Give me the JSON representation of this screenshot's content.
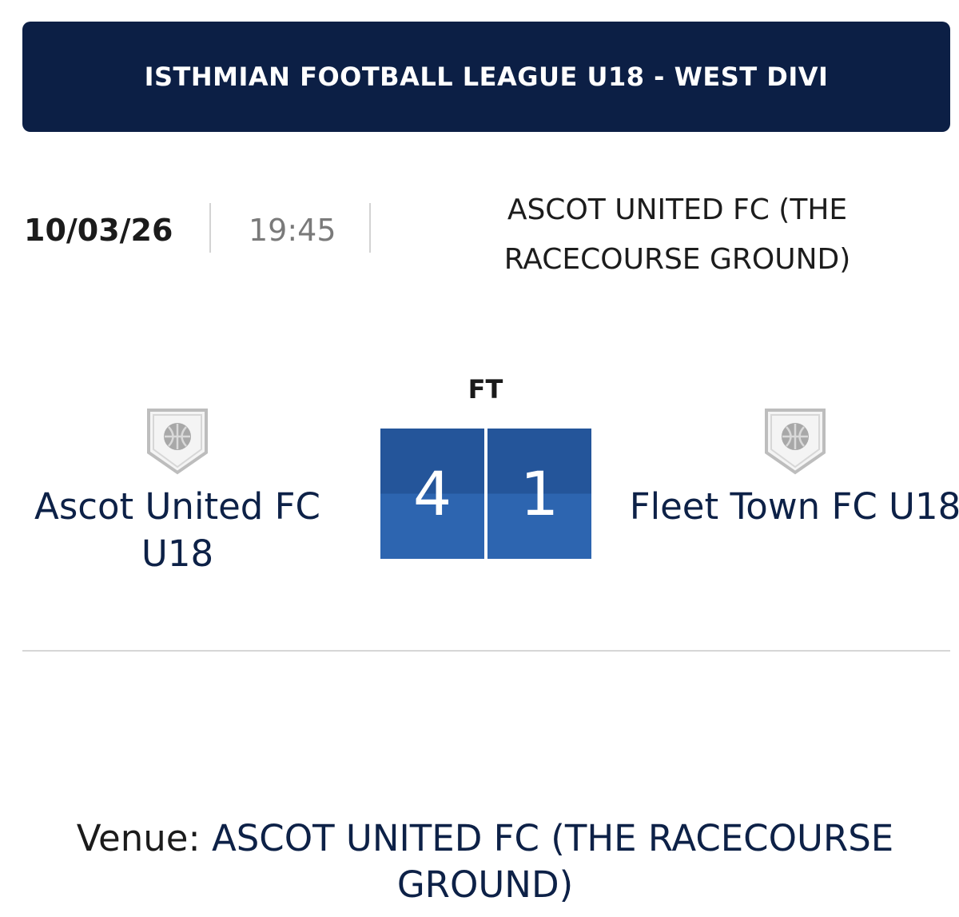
{
  "league": {
    "title": "ISTHMIAN FOOTBALL LEAGUE U18 - WEST DIVI"
  },
  "match": {
    "date": "10/03/26",
    "time": "19:45",
    "venue_header": "ASCOT UNITED FC (THE RACECOURSE GROUND)",
    "status": "FT"
  },
  "home": {
    "name": "Ascot United FC U18",
    "score": "4",
    "crest_icon": "shield-football-icon"
  },
  "away": {
    "name": "Fleet Town FC U18",
    "score": "1",
    "crest_icon": "shield-football-icon"
  },
  "footer": {
    "venue_label": "Venue: ",
    "venue_value": "ASCOT UNITED FC (THE RACECOURSE GROUND)"
  },
  "colors": {
    "banner": "#0c1f45",
    "score_top": "#24559a",
    "score_bottom": "#2d65b0",
    "team_text": "#0d2147"
  }
}
